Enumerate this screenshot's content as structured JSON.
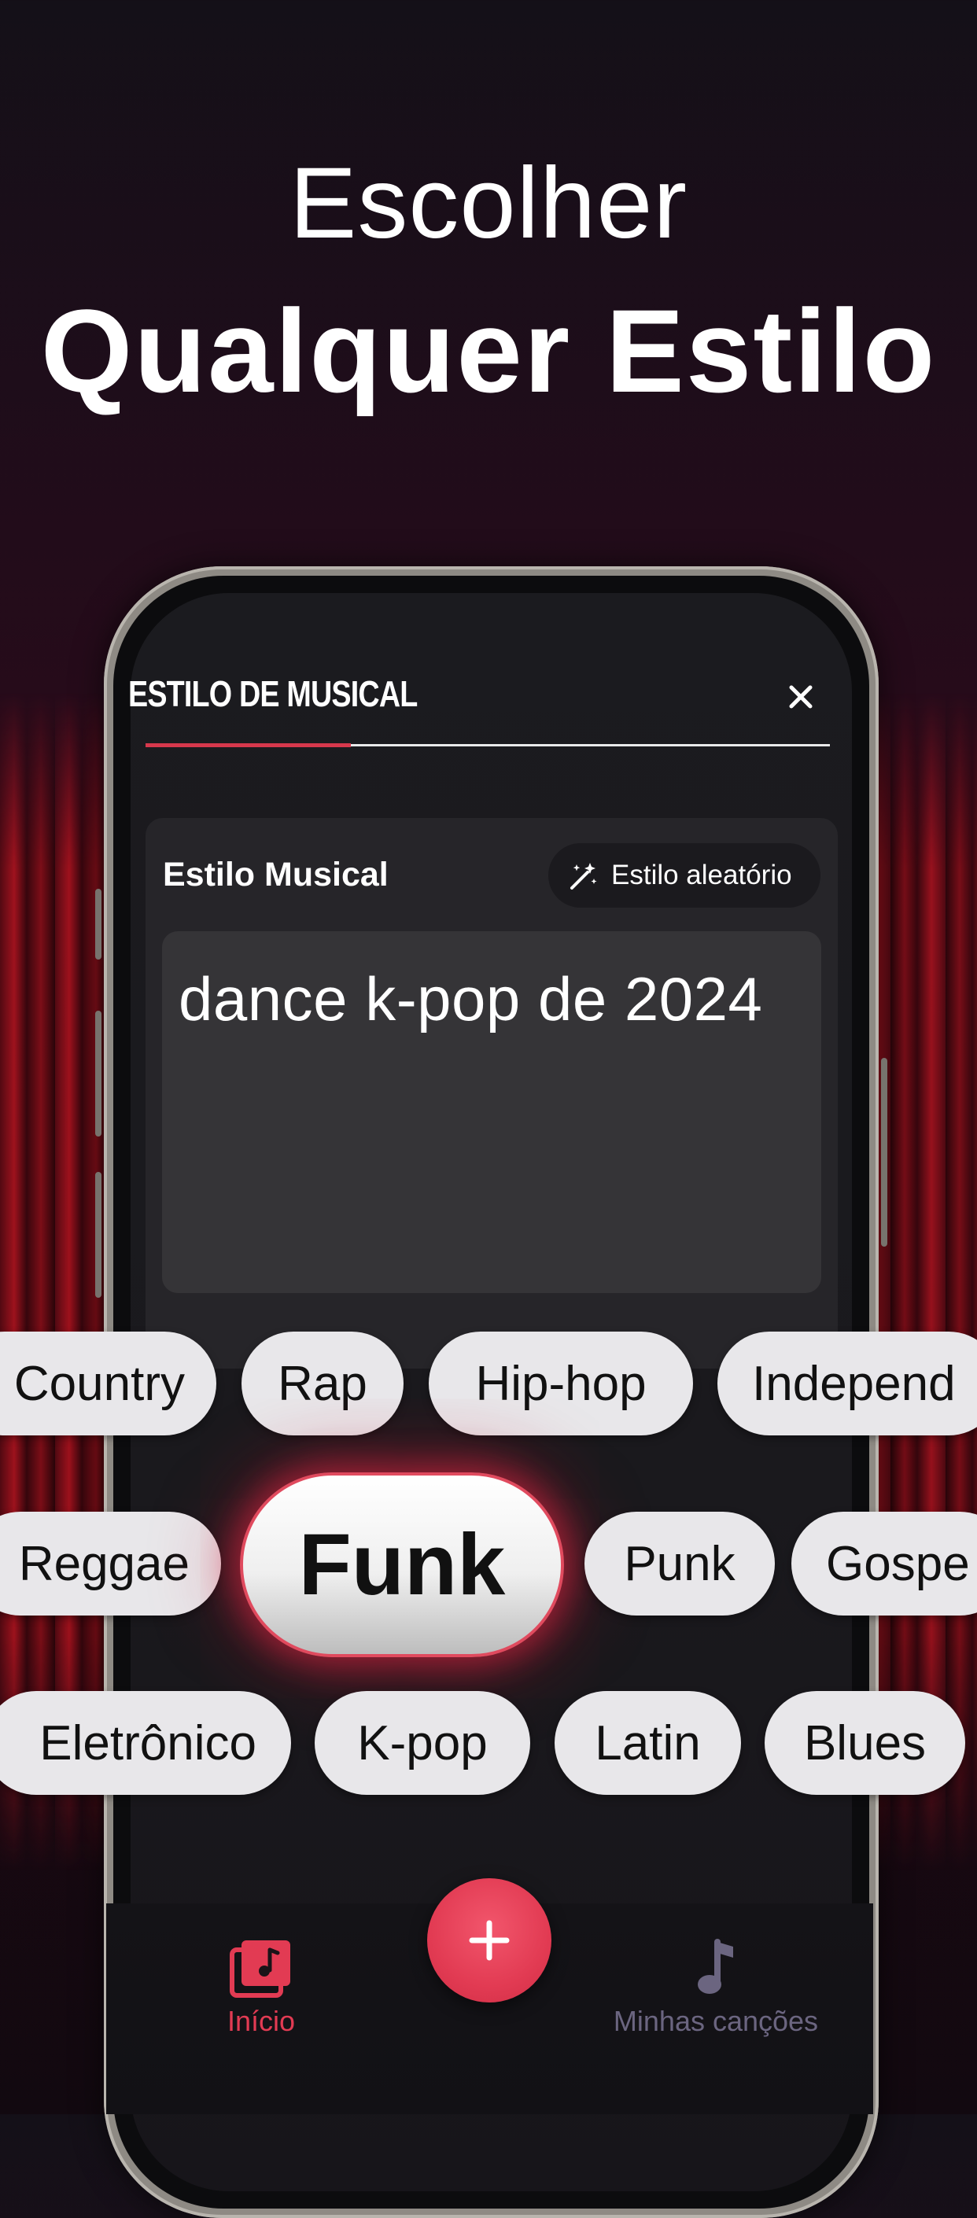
{
  "headline": {
    "line1": "Escolher",
    "line2": "Qualquer Estilo"
  },
  "modal": {
    "title": "ESTILO DE  MUSICAL",
    "close_icon": "close-icon",
    "progress": 0.3
  },
  "style_card": {
    "label": "Estilo Musical",
    "random_button": {
      "label": "Estilo aleatório",
      "icon": "magic-wand-icon"
    },
    "text_value": "dance k-pop de 2024"
  },
  "genres": {
    "row1": [
      "Country",
      "Rap",
      "Hip-hop",
      "Independ"
    ],
    "row2": [
      "Reggae",
      "Funk",
      "Punk",
      "Gospe"
    ],
    "row3": [
      "Eletrônico",
      "K-pop",
      "Latin",
      "Blues"
    ],
    "selected": "Funk"
  },
  "tabbar": {
    "home": {
      "label": "Início",
      "icon": "music-library-icon"
    },
    "add": {
      "icon": "plus-icon"
    },
    "songs": {
      "label": "Minhas canções",
      "icon": "music-note-icon"
    }
  },
  "colors": {
    "accent": "#e23b53",
    "tab_inactive": "#6b6580",
    "pill_bg": "#e8e7ea"
  }
}
